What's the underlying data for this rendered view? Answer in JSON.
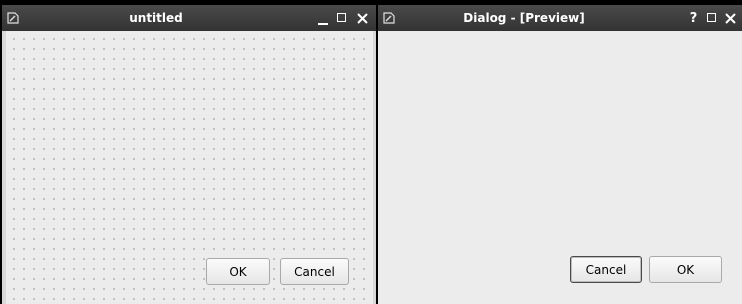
{
  "left_window": {
    "title": "untitled",
    "buttons": {
      "ok": "OK",
      "cancel": "Cancel"
    }
  },
  "right_window": {
    "title": "Dialog - [Preview]",
    "help_glyph": "?",
    "buttons": {
      "cancel": "Cancel",
      "ok": "OK"
    }
  },
  "icons": {
    "app": "designer-app-icon",
    "minimize": "minimize-icon",
    "maximize": "maximize-icon",
    "close": "close-icon",
    "help": "help-icon"
  },
  "colors": {
    "titlebar": "#3d3d3d",
    "canvas": "#ececec",
    "grid_dot": "#9a9a9a"
  }
}
